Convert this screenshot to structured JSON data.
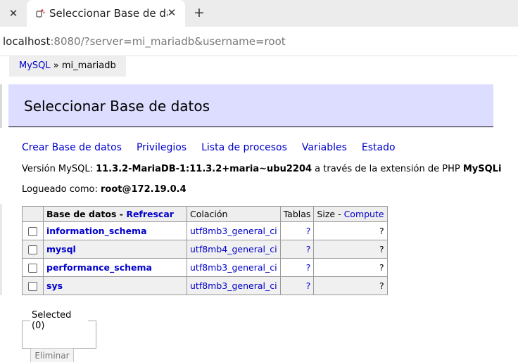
{
  "browser": {
    "tab_title": "Seleccionar Base de datos - Adminer",
    "url_host": "localhost",
    "url_rest": ":8080/?server=mi_mariadb&username=root"
  },
  "breadcrumb": {
    "driver": "MySQL",
    "separator": "»",
    "server": "mi_mariadb"
  },
  "page_title": "Seleccionar Base de datos",
  "links": {
    "create_db": "Crear Base de datos",
    "privileges": "Privilegios",
    "processes": "Lista de procesos",
    "variables": "Variables",
    "status": "Estado"
  },
  "version": {
    "prefix": "Versión MySQL: ",
    "value": "11.3.2-MariaDB-1:11.3.2+maria~ubu2204",
    "middle": " a través de la extensión de PHP ",
    "extension": "MySQLi"
  },
  "login": {
    "prefix": "Logueado como: ",
    "value": "root@172.19.0.4"
  },
  "table": {
    "headers": {
      "database": "Base de datos",
      "dash": " - ",
      "refresh": "Refrescar",
      "collation": "Colación",
      "tables": "Tablas",
      "size": "Size",
      "compute": "Compute"
    },
    "rows": [
      {
        "name": "information_schema",
        "collation": "utf8mb3_general_ci",
        "tables": "?",
        "size": "?"
      },
      {
        "name": "mysql",
        "collation": "utf8mb4_general_ci",
        "tables": "?",
        "size": "?"
      },
      {
        "name": "performance_schema",
        "collation": "utf8mb3_general_ci",
        "tables": "?",
        "size": "?"
      },
      {
        "name": "sys",
        "collation": "utf8mb3_general_ci",
        "tables": "?",
        "size": "?"
      }
    ]
  },
  "selected": {
    "legend": "Selected (0)",
    "delete_label": "Eliminar"
  }
}
